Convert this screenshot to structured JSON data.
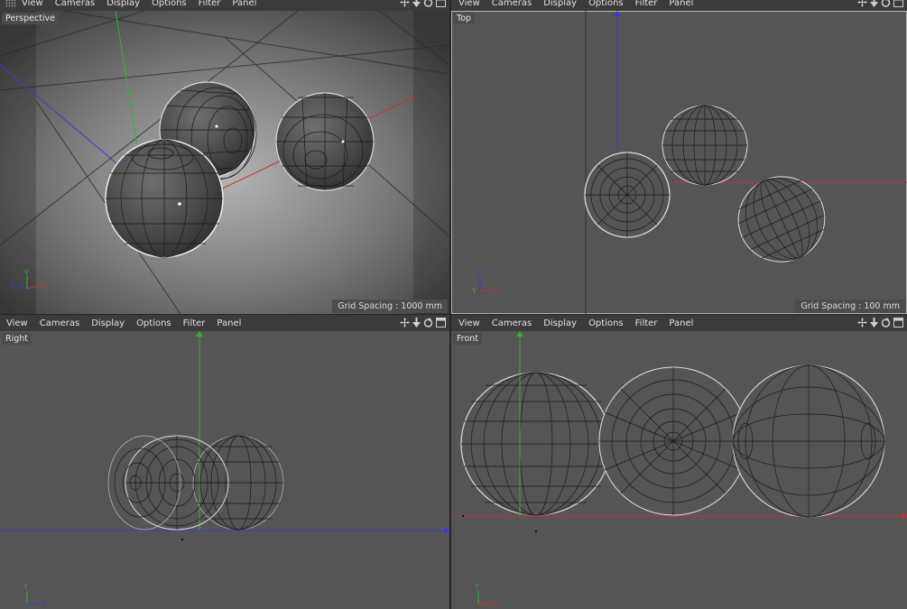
{
  "menu": [
    "View",
    "Cameras",
    "Display",
    "Options",
    "Filter",
    "Panel"
  ],
  "viewports": {
    "perspective": {
      "label": "Perspective",
      "grid_spacing": "Grid Spacing : 1000 mm"
    },
    "top": {
      "label": "Top",
      "grid_spacing": "Grid Spacing : 100 mm"
    },
    "right": {
      "label": "Right"
    },
    "front": {
      "label": "Front"
    }
  },
  "axes": {
    "x": "X",
    "y": "Y",
    "z": "Z"
  },
  "icons": [
    "move-icon",
    "dolly-icon",
    "rotate-icon",
    "maximize-icon"
  ],
  "colors": {
    "x_axis": "#c83030",
    "y_axis": "#32b432",
    "z_axis": "#3c3cd0",
    "active_border": "#b4b4b4"
  }
}
